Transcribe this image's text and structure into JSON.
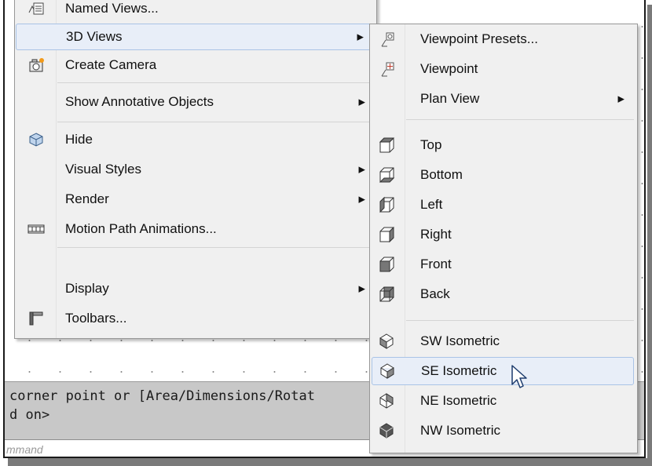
{
  "main_menu": {
    "items": [
      {
        "label": "Named Views...",
        "icon": "named-views-icon"
      },
      {
        "label": "3D Views",
        "submenu": true
      },
      {
        "label": "Create Camera",
        "icon": "camera-icon"
      },
      {
        "label": "Show Annotative Objects",
        "submenu": true
      },
      {
        "label": "Hide",
        "icon": "hide-icon"
      },
      {
        "label": "Visual Styles",
        "submenu": true
      },
      {
        "label": "Render",
        "submenu": true
      },
      {
        "label": "Motion Path Animations...",
        "icon": "film-icon"
      },
      {
        "label": "Display",
        "submenu": true
      },
      {
        "label": "Toolbars...",
        "icon": "toolbars-icon"
      }
    ]
  },
  "submenu_3d_views": {
    "items": [
      {
        "label": "Viewpoint Presets...",
        "icon": "viewpoint-presets-icon"
      },
      {
        "label": "Viewpoint",
        "icon": "viewpoint-icon"
      },
      {
        "label": "Plan View",
        "submenu": true
      },
      {
        "label": "Top",
        "icon": "cube-top-icon"
      },
      {
        "label": "Bottom",
        "icon": "cube-bottom-icon"
      },
      {
        "label": "Left",
        "icon": "cube-left-icon"
      },
      {
        "label": "Right",
        "icon": "cube-right-icon"
      },
      {
        "label": "Front",
        "icon": "cube-front-icon"
      },
      {
        "label": "Back",
        "icon": "cube-back-icon"
      },
      {
        "label": "SW Isometric",
        "icon": "sw-iso-icon"
      },
      {
        "label": "SE Isometric",
        "icon": "se-iso-icon",
        "highlighted": true
      },
      {
        "label": "NE Isometric",
        "icon": "ne-iso-icon"
      },
      {
        "label": "NW Isometric",
        "icon": "nw-iso-icon"
      }
    ]
  },
  "command_history": {
    "line1": "corner point or [Area/Dimensions/Rotat",
    "line2": "d on>"
  },
  "command_prompt": "mmand",
  "colors": {
    "menu_bg": "#f0f0f0",
    "highlight_bg": "#e8eef8",
    "highlight_border": "#a9c3e6",
    "cmd_bg": "#c8c8c8"
  }
}
